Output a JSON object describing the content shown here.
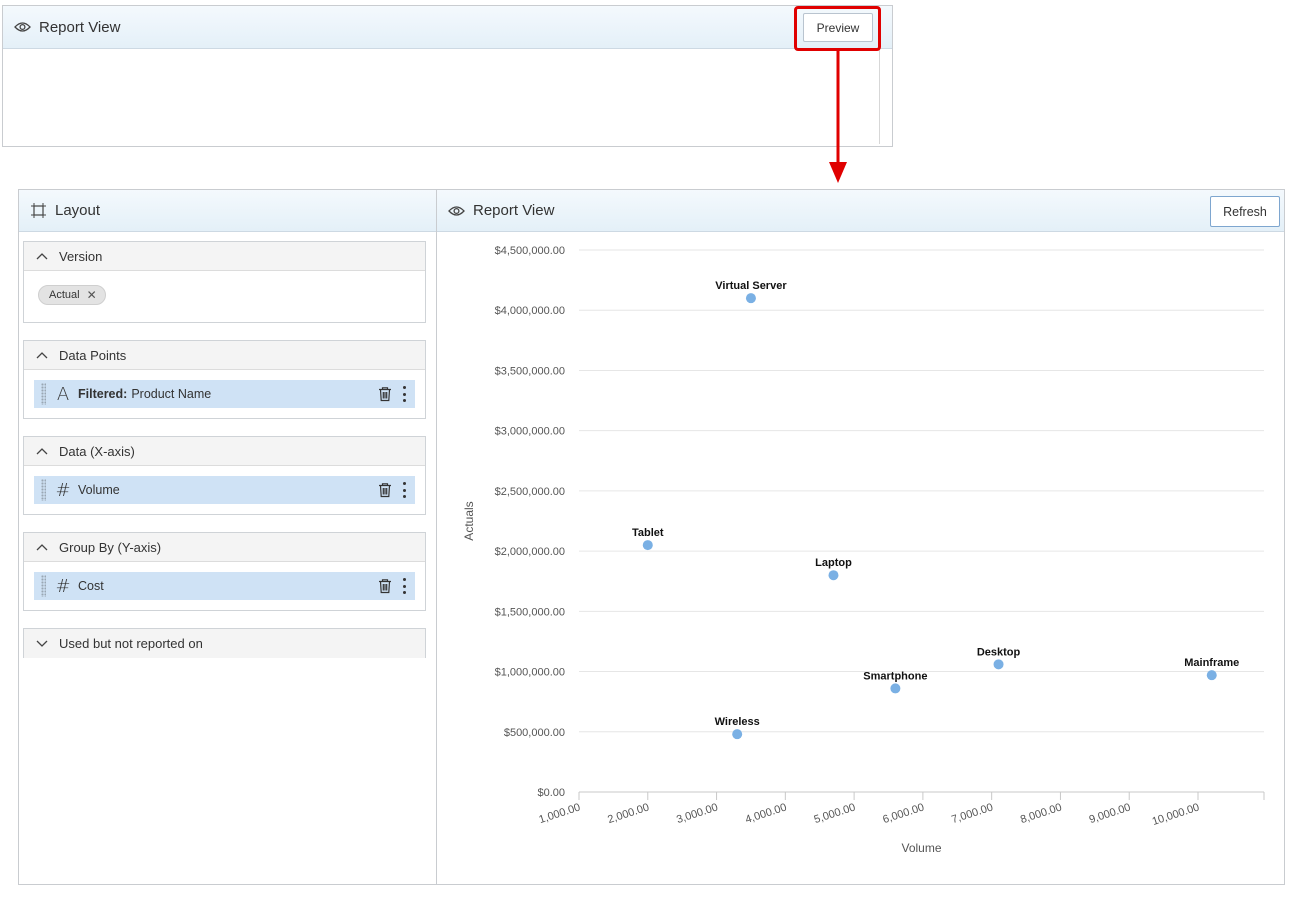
{
  "top_panel": {
    "title": "Report View",
    "icon": "eye-icon",
    "preview_label": "Preview"
  },
  "layout_panel": {
    "title": "Layout",
    "icon": "layout-icon",
    "sections": {
      "version": {
        "title": "Version",
        "chip": "Actual"
      },
      "data_points": {
        "title": "Data Points",
        "field_prefix": "Filtered:",
        "field": "Product Name",
        "type_icon": "A"
      },
      "data_x": {
        "title": "Data (X-axis)",
        "field": "Volume",
        "type_icon": "#"
      },
      "group_by": {
        "title": "Group By (Y-axis)",
        "field": "Cost",
        "type_icon": "#"
      },
      "unused": {
        "title": "Used but not reported on"
      }
    }
  },
  "report_panel": {
    "title": "Report View",
    "icon": "eye-icon",
    "refresh_label": "Refresh"
  },
  "colors": {
    "highlight": "#e00000",
    "point": "#7ab0e4",
    "field_bg": "#cfe2f5"
  },
  "chart_data": {
    "type": "scatter",
    "xlabel": "Volume",
    "ylabel": "Actuals",
    "xlim": [
      1000,
      10000
    ],
    "ylim": [
      0,
      4500000
    ],
    "x_ticks": [
      "1,000.00",
      "2,000.00",
      "3,000.00",
      "4,000.00",
      "5,000.00",
      "6,000.00",
      "7,000.00",
      "8,000.00",
      "9,000.00",
      "10,000.00"
    ],
    "y_ticks": [
      "$4,500,000.00",
      "$4,000,000.00",
      "$3,500,000.00",
      "$3,000,000.00",
      "$2,500,000.00",
      "$2,000,000.00",
      "$1,500,000.00",
      "$1,000,000.00",
      "$500,000.00",
      "$0.00"
    ],
    "grid": true,
    "points": [
      {
        "label": "Virtual Server",
        "x": 3500,
        "y": 4100000
      },
      {
        "label": "Tablet",
        "x": 2000,
        "y": 2050000
      },
      {
        "label": "Laptop",
        "x": 4700,
        "y": 1800000
      },
      {
        "label": "Desktop",
        "x": 7100,
        "y": 1060000
      },
      {
        "label": "Mainframe",
        "x": 10200,
        "y": 970000
      },
      {
        "label": "Smartphone",
        "x": 5600,
        "y": 860000
      },
      {
        "label": "Wireless",
        "x": 3300,
        "y": 480000
      }
    ]
  }
}
